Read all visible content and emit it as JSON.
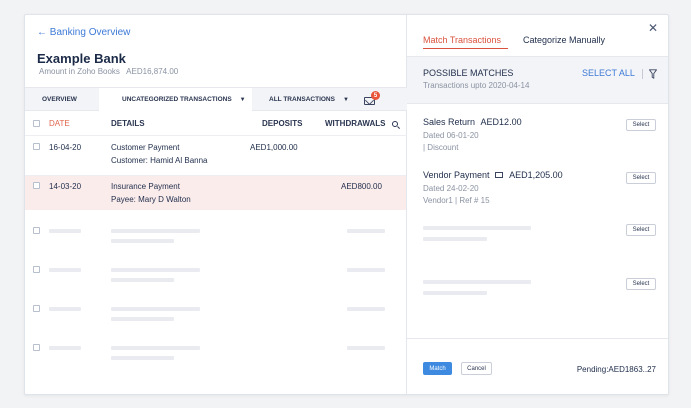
{
  "header": {
    "back_label": "← Banking Overview",
    "bank_name": "Example Bank",
    "amount_label": "Amount in Zoho Books",
    "amount_value": "AED16,874.00"
  },
  "tabs": {
    "overview": "OVERVIEW",
    "uncategorized": "UNCATEGORIZED TRANSACTIONS",
    "all": "ALL TRANSACTIONS",
    "mail_badge": "5"
  },
  "table": {
    "headers": {
      "date": "DATE",
      "details": "DETAILS",
      "deposits": "DEPOSITS",
      "withdrawals": "WITHDRAWALS"
    },
    "rows": [
      {
        "date": "16-04-20",
        "line1": "Customer Payment",
        "line2": "Customer: Hamid Al Banna",
        "deposit": "AED1,000.00",
        "withdrawal": ""
      },
      {
        "date": "14-03-20",
        "line1": "Insurance Payment",
        "line2": "Payee: Mary D Walton",
        "deposit": "",
        "withdrawal": "AED800.00"
      }
    ]
  },
  "panel": {
    "tab_match": "Match Transactions",
    "tab_categorize": "Categorize Manually",
    "title": "POSSIBLE MATCHES",
    "subtitle": "Transactions upto 2020-04-14",
    "select_all": "SELECT ALL",
    "matches": [
      {
        "title": "Sales Return",
        "amount": "AED12.00",
        "line2": "Dated 06-01-20",
        "line3": "| Discount",
        "button": "Select"
      },
      {
        "title": "Vendor Payment",
        "amount": "AED1,205.00",
        "line2": "Dated 24-02-20",
        "line3": "Vendor1 | Ref # 15",
        "button": "Select"
      }
    ],
    "placeholder_buttons": [
      "Select",
      "Select"
    ],
    "match_button": "Match",
    "cancel_button": "Cancel",
    "pending": "Pending:AED1863..27"
  },
  "colors": {
    "accent": "#d9523d",
    "link": "#3d7ad6",
    "highlight_row": "#fbecec",
    "badge": "#e8553a",
    "primary_button": "#3d8ae0"
  }
}
